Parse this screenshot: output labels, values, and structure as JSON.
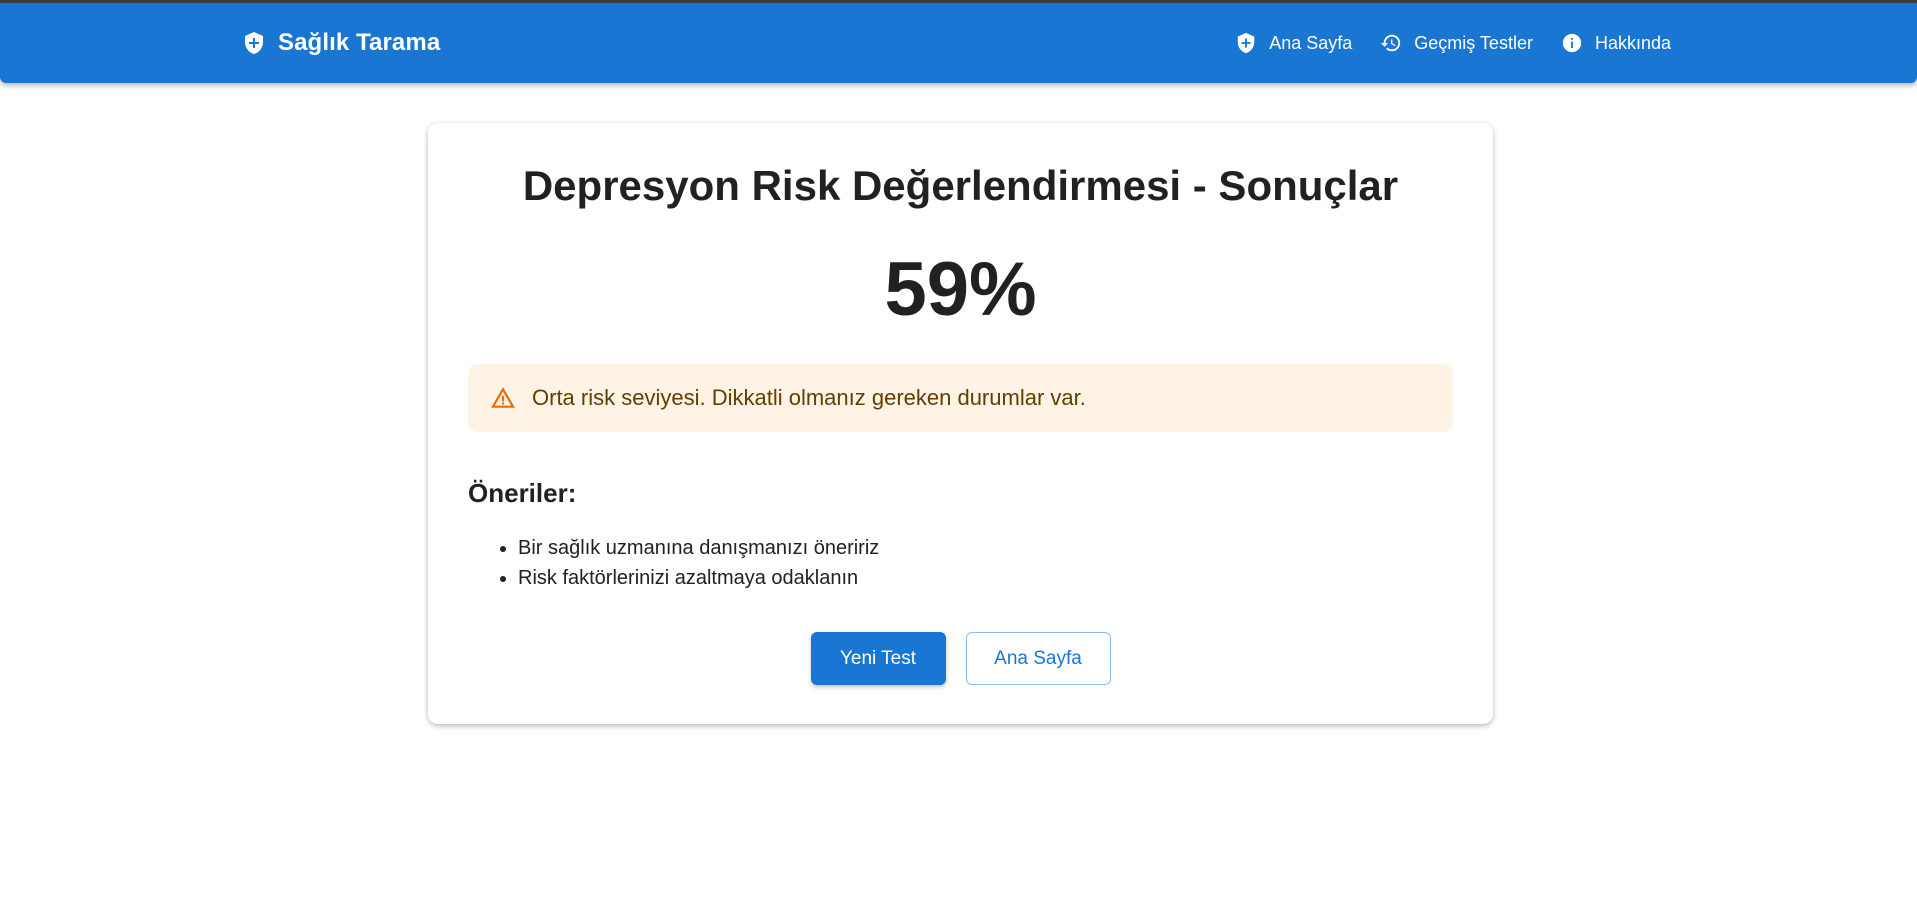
{
  "header": {
    "brand": "Sağlık Tarama",
    "nav": [
      {
        "label": "Ana Sayfa",
        "icon": "shield-plus-icon"
      },
      {
        "label": "Geçmiş Testler",
        "icon": "history-icon"
      },
      {
        "label": "Hakkında",
        "icon": "info-icon"
      }
    ]
  },
  "result": {
    "title": "Depresyon Risk Değerlendirmesi - Sonuçlar",
    "score": "59%",
    "alert": {
      "text": "Orta risk seviyesi. Dikkatli olmanız gereken durumlar var.",
      "icon": "warning-icon"
    },
    "recommendations_title": "Öneriler:",
    "recommendations": [
      "Bir sağlık uzmanına danışmanızı öneririz",
      "Risk faktörlerinizi azaltmaya odaklanın"
    ],
    "buttons": {
      "new_test": "Yeni Test",
      "home": "Ana Sayfa"
    }
  },
  "colors": {
    "primary": "#1976d2",
    "alert_bg": "#fff3e6",
    "alert_icon": "#ed6c02",
    "alert_text": "#663c00"
  }
}
